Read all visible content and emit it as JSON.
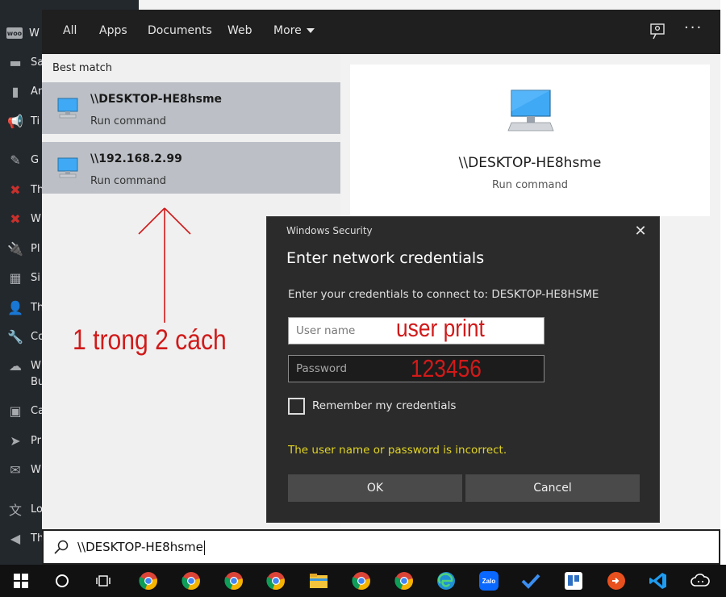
{
  "background_sidebar": {
    "items": [
      {
        "icon": "woo-icon",
        "label": "W"
      },
      {
        "icon": "sales-icon",
        "label": "Sa"
      },
      {
        "icon": "analytics-icon",
        "label": "An"
      },
      {
        "icon": "marketing-icon",
        "label": "Ti"
      },
      {
        "icon": "tools-icon",
        "label": "G"
      },
      {
        "icon": "plugin-x-icon",
        "label": "Th"
      },
      {
        "icon": "plugin-x-icon-2",
        "label": "W"
      },
      {
        "icon": "plugins-icon",
        "label": "Pl"
      },
      {
        "icon": "site-icon",
        "label": "Si"
      },
      {
        "icon": "users-icon",
        "label": "Th"
      },
      {
        "icon": "settings-icon",
        "label": "Co"
      },
      {
        "icon": "cloud-icon",
        "label": "W"
      },
      {
        "icon": "cloud-icon-sub",
        "label": "Bu"
      },
      {
        "icon": "calc-icon",
        "label": "Ca"
      },
      {
        "icon": "arrow-circle-icon",
        "label": "Pr"
      },
      {
        "icon": "mail-icon",
        "label": "W"
      },
      {
        "icon": "translate-icon",
        "label": "Lo"
      },
      {
        "icon": "play-icon",
        "label": "Th"
      }
    ]
  },
  "search_tabs": {
    "all": "All",
    "apps": "Apps",
    "documents": "Documents",
    "web": "Web",
    "more": "More"
  },
  "results": {
    "heading": "Best match",
    "items": [
      {
        "title": "\\\\DESKTOP-HE8hsme",
        "subtitle": "Run command"
      },
      {
        "title": "\\\\192.168.2.99",
        "subtitle": "Run command"
      }
    ]
  },
  "preview": {
    "title": "\\\\DESKTOP-HE8hsme",
    "subtitle": "Run command"
  },
  "search": {
    "query": "\\\\DESKTOP-HE8hsme"
  },
  "annotation": {
    "text": "1 trong 2 cách",
    "color": "#d11a1a"
  },
  "dialog": {
    "caption": "Windows Security",
    "title": "Enter network credentials",
    "prompt": "Enter your credentials to connect to: DESKTOP-HE8HSME",
    "username_placeholder": "User name",
    "password_placeholder": "Password",
    "username_handwritten": "user print",
    "password_handwritten": "123456",
    "remember_label": "Remember my credentials",
    "remember_checked": false,
    "error": "The user name or password is incorrect.",
    "ok_label": "OK",
    "cancel_label": "Cancel",
    "error_color": "#e1d424"
  },
  "taskbar": {
    "icons": [
      "windows-start-icon",
      "cortana-icon",
      "task-view-icon",
      "chrome-icon",
      "chrome-icon",
      "chrome-icon",
      "chrome-icon",
      "file-explorer-icon",
      "chrome-icon",
      "chrome-icon",
      "edge-icon",
      "zalo-icon",
      "todo-icon",
      "trello-icon",
      "remote-desktop-icon",
      "vscode-icon",
      "cloud-app-icon"
    ],
    "zalo_label": "Zalo"
  }
}
